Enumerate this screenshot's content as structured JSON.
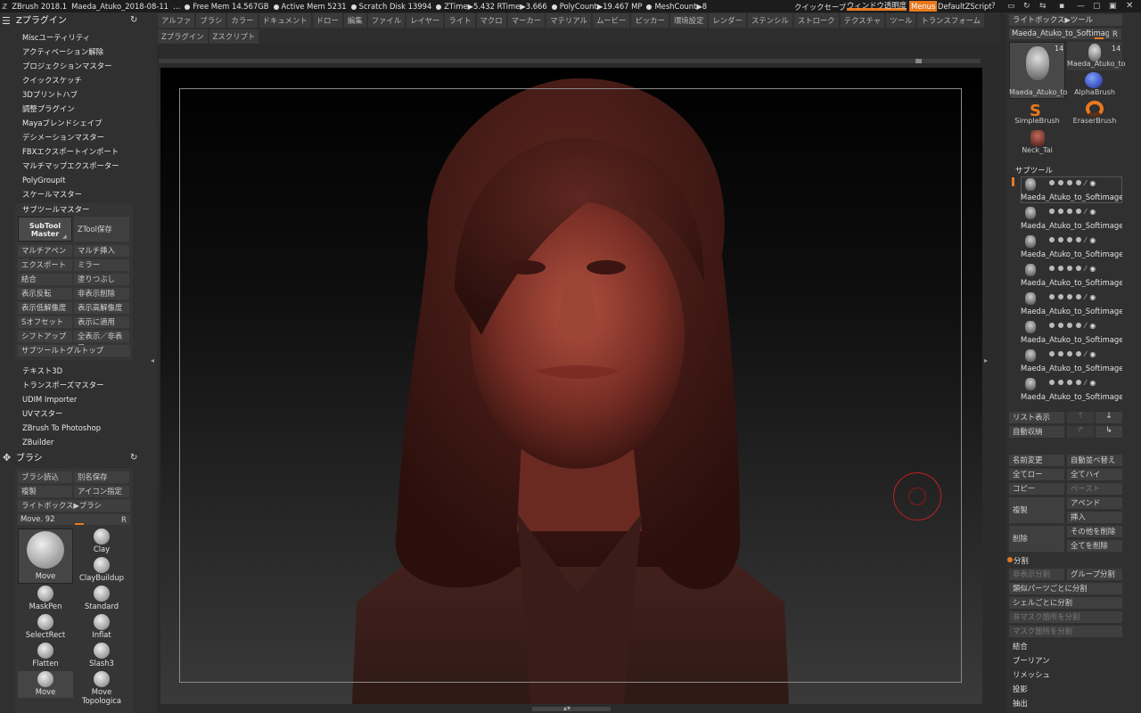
{
  "topbar": {
    "app": "ZBrush 2018.1",
    "file": "Maeda_Atuko_2018-08-11",
    "ellipsis": "…",
    "free_mem": "Free Mem 14.567GB",
    "active_mem": "Active Mem 5231",
    "scratch": "Scratch Disk 13994",
    "ztime": "ZTime▶5.432 RTime▶3.666",
    "polycount": "PolyCount▶19.467 MP",
    "meshcount": "MeshCount▶8",
    "quicksave": "クイックセーブ",
    "window_transparency": "ウィンドウ透明度",
    "menus": "Menus",
    "zscript": "DefaultZScript"
  },
  "menubar": {
    "row1": [
      "アルファ",
      "ブラシ",
      "カラー",
      "ドキュメント",
      "ドロー",
      "編集",
      "ファイル",
      "レイヤー",
      "ライト",
      "マクロ",
      "マーカー",
      "マテリアル",
      "ムービー",
      "ピッカー",
      "環境設定",
      "レンダー",
      "ステンシル",
      "ストローク",
      "テクスチャ",
      "ツール",
      "トランスフォーム"
    ],
    "row2": [
      "Zプラグイン",
      "Zスクリプト"
    ]
  },
  "left": {
    "plugin_title": "Zプラグイン",
    "plugins": [
      "Miscユーティリティ",
      "アクティベーション解除",
      "プロジェクションマスター",
      "クイックスケッチ",
      "3Dプリントハブ",
      "調整プラグイン",
      "Mayaブレンドシェイプ",
      "デシメーションマスター",
      "FBXエクスポートインポート",
      "マルチマップエクスポーター",
      "PolyGroupIt",
      "スケールマスター"
    ],
    "subtool_master": "サブツールマスター",
    "subtool_master_btn": "SubTool Master",
    "ztool_save": "ZTool保存",
    "grid_buttons": [
      "マルチアペンド",
      "マルチ挿入",
      "エクスポート",
      "ミラー",
      "結合",
      "塗りつぶし",
      "表示反転",
      "非表示削除",
      "表示低解像度",
      "表示高解像度",
      "Sオフセット",
      "表示に適用",
      "シフトアップ",
      "全表示／非表示"
    ],
    "subtool_toggle": "サブツールトグルトップ",
    "plugins2": [
      "テキスト3D",
      "トランスポーズマスター",
      "UDIM Importer",
      "UVマスター",
      "ZBrush To Photoshop",
      "ZBuilder"
    ],
    "brush_title": "ブラシ",
    "brush_buttons": [
      "ブラシ読込",
      "別名保存",
      "複製",
      "アイコン指定"
    ],
    "lightbox_brush": "ライトボックス▶ブラシ",
    "brush_value": "Move. 92",
    "r_label": "R",
    "brushes": [
      "Move",
      "Clay",
      "ClayBuildup",
      "MaskPen",
      "Standard",
      "SelectRect",
      "Inflat",
      "Flatten",
      "Slash3",
      "Move",
      "Move Topologica"
    ]
  },
  "right": {
    "lightbox_tool": "ライトボックス▶ツール",
    "tool_name": "Maeda_Atuko_to_Softimage",
    "r_label": "R",
    "thumbs": [
      "Maeda_Atuko_to",
      "Maeda_Atuko_to",
      "AlphaBrush",
      "SimpleBrush",
      "EraserBrush",
      "Neck_Tai"
    ],
    "thumb_counts": [
      "14",
      "14"
    ],
    "subtool_title": "サブツール",
    "subtools": [
      "Maeda_Atuko_to_Softimage_",
      "Maeda_Atuko_to_Softimage_",
      "Maeda_Atuko_to_Softimage_",
      "Maeda_Atuko_to_Softimage_",
      "Maeda_Atuko_to_Softimage_",
      "Maeda_Atuko_to_Softimage_",
      "Maeda_Atuko_to_Softimage_",
      "Maeda_Atuko_to_Softimage_"
    ],
    "list_view": "リスト表示",
    "auto_collapse": "自動収納",
    "rename": "名前変更",
    "auto_reorder": "自動並べ替え",
    "all_low": "全てロー",
    "all_high": "全てハイ",
    "copy": "コピー",
    "paste": "ペースト",
    "duplicate": "複製",
    "append": "アペンド",
    "insert": "挿入",
    "delete": "削除",
    "delete_other": "その他を削除",
    "delete_all": "全てを削除",
    "split_title": "分割",
    "split_hidden": "非表示分割",
    "group_split": "グループ分割",
    "split_similar": "類似パーツごとに分割",
    "split_shell": "シェルごとに分割",
    "split_unmasked": "非マスク箇所を分割",
    "split_masked": "マスク箇所を分割",
    "merge": "結合",
    "boolean": "ブーリアン",
    "remesh": "リメッシュ",
    "project": "投影",
    "extract": "抽出"
  },
  "colors": {
    "accent": "#e8791e",
    "cursor": "#c0201e"
  }
}
